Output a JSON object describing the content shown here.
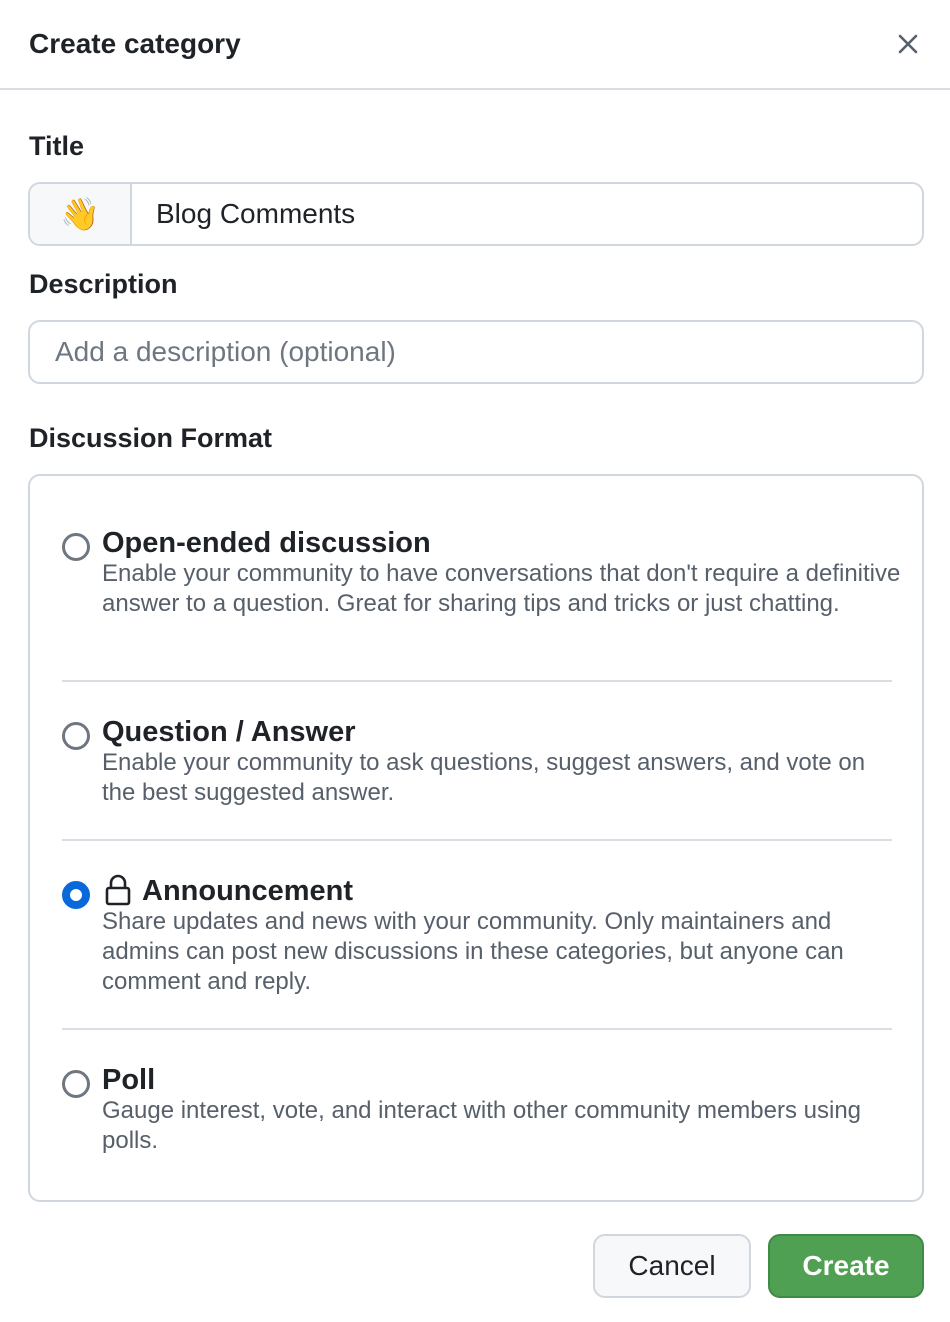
{
  "dialog": {
    "title": "Create category",
    "close_icon": "close-icon"
  },
  "form": {
    "title_label": "Title",
    "title_emoji": "👋",
    "title_value": "Blog Comments",
    "description_label": "Description",
    "description_placeholder": "Add a description (optional)",
    "description_value": "",
    "format_label": "Discussion Format"
  },
  "formats": [
    {
      "title": "Open-ended discussion",
      "description": "Enable your community to have conversations that don't require a definitive answer to a question. Great for sharing tips and tricks or just chatting.",
      "selected": false
    },
    {
      "title": "Question / Answer",
      "description": "Enable your community to ask questions, suggest answers, and vote on the best suggested answer.",
      "selected": false
    },
    {
      "title": "Announcement",
      "description": "Share updates and news with your community. Only maintainers and admins can post new discussions in these categories, but anyone can comment and reply.",
      "selected": true,
      "icon": "lock-icon"
    },
    {
      "title": "Poll",
      "description": "Gauge interest, vote, and interact with other community members using polls.",
      "selected": false
    }
  ],
  "actions": {
    "cancel_label": "Cancel",
    "create_label": "Create"
  },
  "colors": {
    "accent_blue": "#0969da",
    "create_green": "#4fa052",
    "border": "#d0d7de",
    "muted_text": "#57606a"
  }
}
